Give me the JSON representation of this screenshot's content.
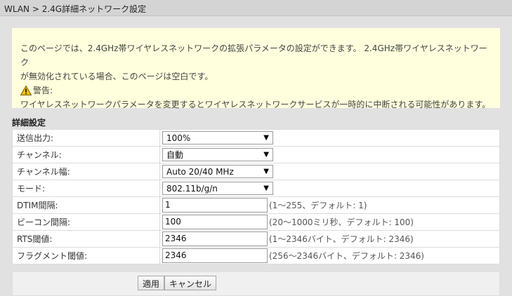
{
  "breadcrumb": "WLAN > 2.4G詳細ネットワーク設定",
  "notice": {
    "line1": "このページでは、2.4GHz帯ワイヤレスネットワークの拡張パラメータの設定ができます。 2.4GHz帯ワイヤレスネットワーク",
    "line2": "が無効化されている場合、このページは空白です。",
    "warning_label": "警告:",
    "warning_text": "ワイヤレスネットワークパラメータを変更するとワイヤレスネットワークサービスが一時的に中断される可能性があります。"
  },
  "section_title": "詳細設定",
  "rows": [
    {
      "label": "送信出力:",
      "value": "100%"
    },
    {
      "label": "チャンネル:",
      "value": "自動"
    },
    {
      "label": "チャンネル幅:",
      "value": "Auto 20/40 MHz"
    },
    {
      "label": "モード:",
      "value": "802.11b/g/n"
    },
    {
      "label": "DTIM間隔:",
      "value": "1",
      "hint": "(1〜255、デフォルト: 1)"
    },
    {
      "label": "ビーコン間隔:",
      "value": "100",
      "hint": "(20〜1000ミリ秒、デフォルト: 100)"
    },
    {
      "label": "RTS閾値:",
      "value": "2346",
      "hint": "(1〜2346バイト、デフォルト: 2346)"
    },
    {
      "label": "フラグメント閾値:",
      "value": "2346",
      "hint": "(256〜2346バイト、デフォルト: 2346)"
    }
  ],
  "buttons": {
    "apply": "適用",
    "cancel": "キャンセル"
  },
  "colors": {
    "notice_bg": "#ffffdd",
    "page_bg": "#e1e1e1",
    "warning": "#f2c200"
  },
  "icons": {
    "warning": "warning-icon",
    "dropdown": "chevron-down-icon"
  }
}
